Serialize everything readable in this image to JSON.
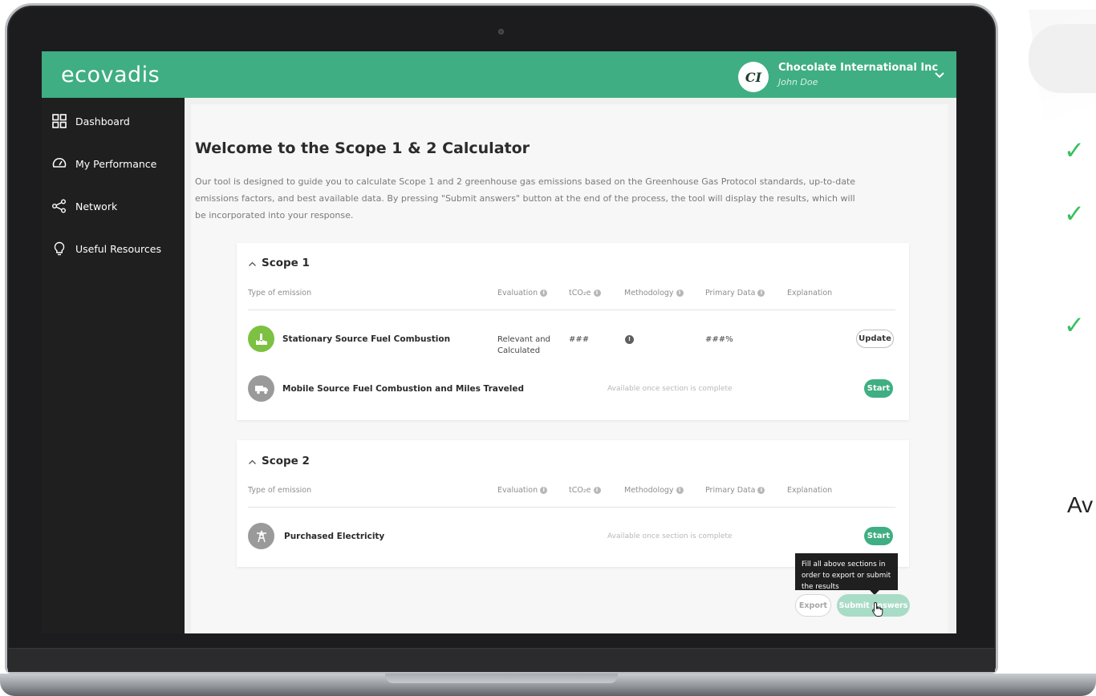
{
  "brand": {
    "logo_text": "ecovadis",
    "accent_color": "#3fae83"
  },
  "account": {
    "avatar_initials": "CI",
    "company_name": "Chocolate International Inc",
    "user_name": "John Doe"
  },
  "sidebar": {
    "items": [
      {
        "label": "Dashboard",
        "icon": "dashboard-grid-icon"
      },
      {
        "label": "My Performance",
        "icon": "gauge-icon"
      },
      {
        "label": "Network",
        "icon": "network-share-icon"
      },
      {
        "label": "Useful Resources",
        "icon": "lightbulb-icon"
      }
    ]
  },
  "page": {
    "title": "Welcome to the Scope 1 & 2 Calculator",
    "intro": "Our tool is designed to guide you to calculate Scope 1 and 2 greenhouse gas emissions based on the Greenhouse Gas Protocol standards, up-to-date emissions factors, and best available data. By pressing \"Submit answers\" button at the end of the process, the tool will display the results, which will be incorporated into your response."
  },
  "columns": {
    "type": "Type of emission",
    "evaluation": "Evaluation",
    "tco2e": "tCO₂e",
    "methodology": "Methodology",
    "primary_data": "Primary Data",
    "explanation": "Explanation"
  },
  "scope1": {
    "title": "Scope 1",
    "rows": [
      {
        "name": "Stationary Source Fuel Combustion",
        "icon": "factory-icon",
        "evaluation": "Relevant and Calculated",
        "tco2e": "###",
        "primary_data": "###%",
        "action": "Update"
      },
      {
        "name": "Mobile Source Fuel Combustion and Miles Traveled",
        "icon": "truck-icon",
        "status": "Available once section is complete",
        "action": "Start"
      }
    ]
  },
  "scope2": {
    "title": "Scope 2",
    "rows": [
      {
        "name": "Purchased Electricity",
        "icon": "power-tower-icon",
        "status": "Available once section is complete",
        "action": "Start"
      }
    ]
  },
  "footer": {
    "tooltip": "Fill all above sections in order to export or submit the results",
    "export_label": "Export",
    "submit_label": "Submit answers"
  },
  "slide": {
    "side_text": "Av"
  }
}
